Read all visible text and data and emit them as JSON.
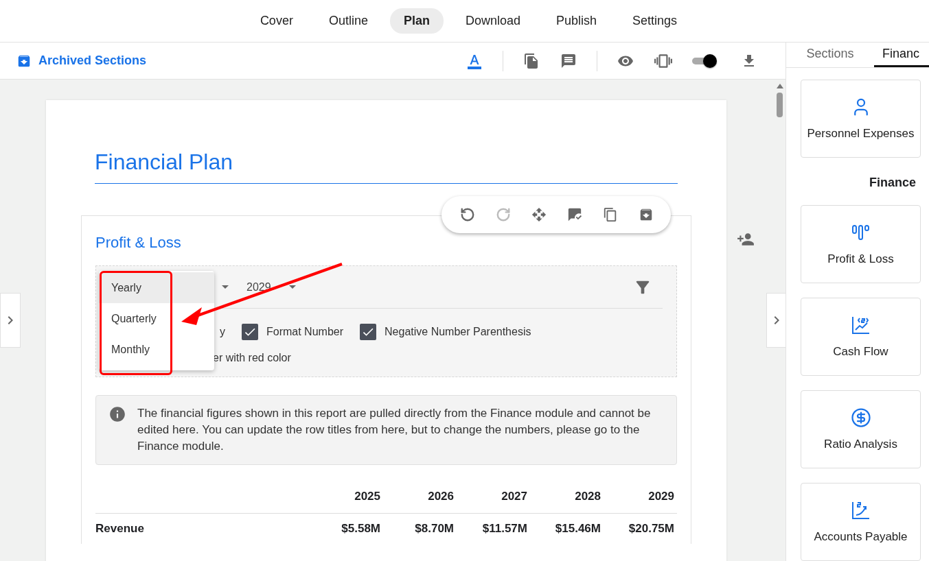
{
  "nav_tabs": [
    {
      "label": "Cover",
      "selected": false
    },
    {
      "label": "Outline",
      "selected": false
    },
    {
      "label": "Plan",
      "selected": true
    },
    {
      "label": "Download",
      "selected": false
    },
    {
      "label": "Publish",
      "selected": false
    },
    {
      "label": "Settings",
      "selected": false
    }
  ],
  "toolbar": {
    "archived_label": "Archived Sections",
    "toggle": {
      "on": true
    }
  },
  "document": {
    "title": "Financial Plan",
    "section": {
      "title": "Profit & Loss",
      "year_select": {
        "value": "2029"
      },
      "period_menu": [
        {
          "label": "Yearly",
          "selected": true
        },
        {
          "label": "Quarterly",
          "selected": false
        },
        {
          "label": "Monthly",
          "selected": false
        }
      ],
      "partly_covered_texts": [
        "y",
        "er with red color"
      ],
      "checkboxes": [
        {
          "label": "Format Number",
          "checked": true
        },
        {
          "label": "Negative Number Parenthesis",
          "checked": true
        }
      ],
      "info": "The financial figures shown in this report are pulled directly from the Finance module and cannot be edited here. You can update the row titles from here, but to change the numbers, please go to the Finance module.",
      "table": {
        "columns": [
          "2025",
          "2026",
          "2027",
          "2028",
          "2029"
        ],
        "rows": [
          {
            "label": "Revenue",
            "values": [
              "$5.58M",
              "$8.70M",
              "$11.57M",
              "$15.46M",
              "$20.75M"
            ]
          }
        ]
      }
    }
  },
  "side_panel": {
    "tabs": [
      {
        "label": "Sections",
        "selected": false
      },
      {
        "label": "Financ",
        "selected": true
      }
    ],
    "top_cards": [
      "Personnel Expenses"
    ],
    "heading": "Finance",
    "cards": [
      "Profit & Loss",
      "Cash Flow",
      "Ratio Analysis",
      "Accounts Payable"
    ]
  }
}
